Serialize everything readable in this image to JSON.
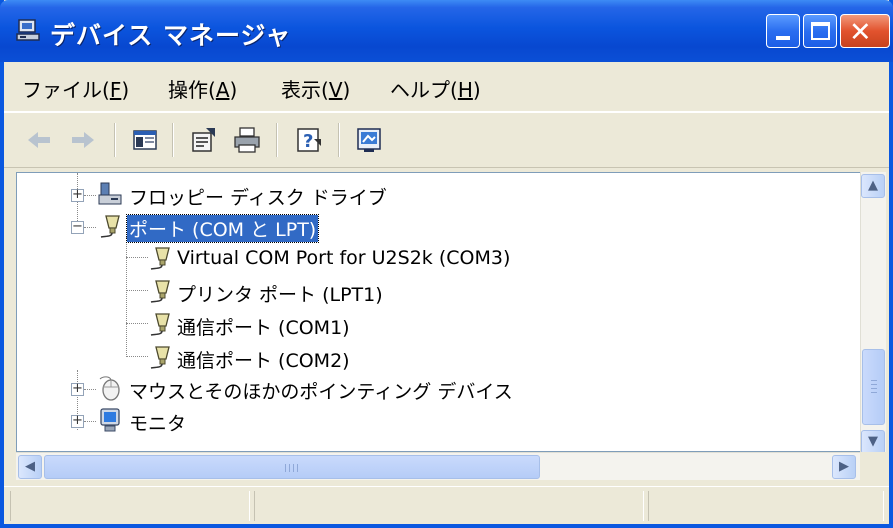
{
  "window": {
    "title": "デバイス マネージャ",
    "icon": "device-manager-icon"
  },
  "menu": [
    {
      "label": "ファイル(",
      "key": "F",
      "tail": ")"
    },
    {
      "label": "操作(",
      "key": "A",
      "tail": ")"
    },
    {
      "label": "表示(",
      "key": "V",
      "tail": ")"
    },
    {
      "label": "ヘルプ(",
      "key": "H",
      "tail": ")"
    }
  ],
  "toolbar": {
    "icons": [
      "back-arrow-icon",
      "forward-arrow-icon",
      "show-hide-console-tree-icon",
      "properties-icon",
      "print-icon",
      "help-icon",
      "scan-hardware-icon"
    ]
  },
  "tree": {
    "items": [
      {
        "label": "フロッピー ディスク ドライブ",
        "icon": "floppy-drive-icon",
        "expander": "+",
        "level": 0
      },
      {
        "label": "ポート (COM と LPT)",
        "icon": "port-connector-icon",
        "expander": "−",
        "level": 0,
        "selected": true
      },
      {
        "label": "Virtual COM Port for U2S2k (COM3)",
        "icon": "port-connector-icon",
        "level": 1
      },
      {
        "label": "プリンタ ポート (LPT1)",
        "icon": "port-connector-icon",
        "level": 1
      },
      {
        "label": "通信ポート (COM1)",
        "icon": "port-connector-icon",
        "level": 1
      },
      {
        "label": "通信ポート (COM2)",
        "icon": "port-connector-icon",
        "level": 1
      },
      {
        "label": "マウスとそのほかのポインティング デバイス",
        "icon": "mouse-icon",
        "expander": "+",
        "level": 0
      },
      {
        "label": "モニタ",
        "icon": "monitor-icon",
        "expander": "+",
        "level": 0
      }
    ]
  },
  "statusbar": {
    "cells": [
      "",
      "",
      ""
    ]
  },
  "colors": {
    "titlebar": "#0b55de",
    "selection": "#316ac5",
    "window_bg": "#ece9d8"
  }
}
